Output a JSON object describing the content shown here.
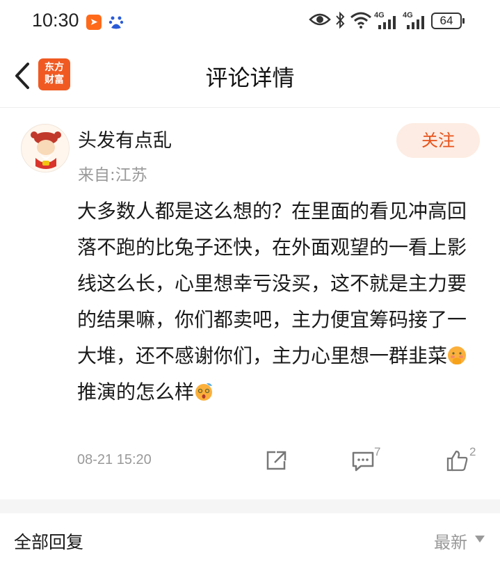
{
  "status_bar": {
    "time": "10:30",
    "battery": "64",
    "icons": [
      "message-app-icon",
      "baidu-icon",
      "eye-icon",
      "bluetooth-icon",
      "wifi-icon",
      "signal-4g-icon",
      "signal-4g-icon"
    ],
    "network_labels": [
      "4G",
      "4G"
    ]
  },
  "header": {
    "title": "评论详情",
    "logo_line1": "东方",
    "logo_line2": "财富",
    "accent_color": "#f05a22"
  },
  "comment": {
    "username": "头发有点乱",
    "location": "来自:江苏",
    "follow_label": "关注",
    "text_part1": "大多数人都是这么想的？在里面的看见冲高回落不跑的比兔子还快，在外面观望的一看上影线这么长，心里想幸亏没买，这不就是主力要的结果嘛，你们都卖吧，主力便宜筹码接了一大堆，还不感谢你们，主力心里想一群韭菜",
    "text_part2": "推演的怎么样",
    "emoji1": "hand-over-mouth-emoji",
    "emoji2": "dizzy-face-emoji",
    "date": "08-21 15:20",
    "reply_count": "7",
    "like_count": "2"
  },
  "replies_section": {
    "label": "全部回复",
    "sort_label": "最新"
  }
}
